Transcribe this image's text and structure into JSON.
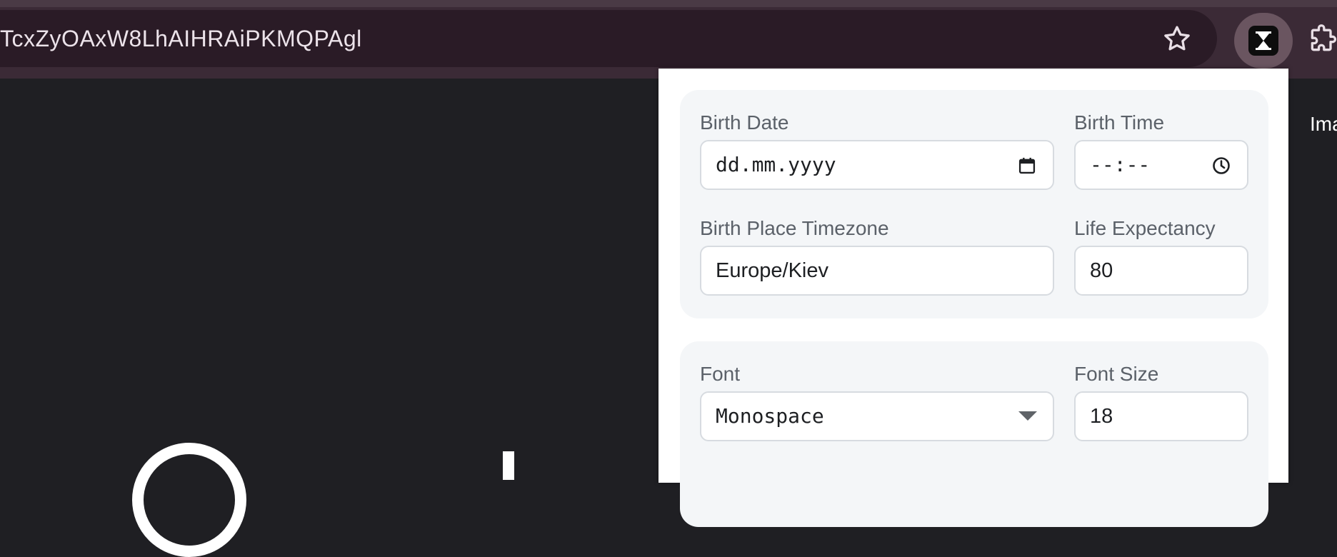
{
  "browser": {
    "address_bar": {
      "url_text": "TcxZyOAxW8LhAIHRAiPKMQPAgl"
    },
    "icons": {
      "bookmark": "star-icon",
      "active_extension": "hourglass-icon",
      "extensions_menu": "puzzle-icon"
    },
    "colors": {
      "toolbar": "#3b2a36",
      "omnibox": "#2a1b26",
      "page_background": "#1f1f23"
    }
  },
  "page": {
    "side_text": "Ima"
  },
  "popup": {
    "birth_date": {
      "label": "Birth Date",
      "placeholder": "dd.mm.yyyy",
      "icon": "calendar-icon"
    },
    "birth_time": {
      "label": "Birth Time",
      "placeholder": "--:--",
      "icon": "clock-icon"
    },
    "timezone": {
      "label": "Birth Place Timezone",
      "value": "Europe/Kiev"
    },
    "life_expectancy": {
      "label": "Life Expectancy",
      "value": "80"
    },
    "font": {
      "label": "Font",
      "selected": "Monospace",
      "icon": "dropdown-arrow-icon"
    },
    "font_size": {
      "label": "Font Size",
      "value": "18"
    },
    "colors": {
      "card_background": "#f4f6f8",
      "field_border": "#d7dbe0",
      "label_text": "#5b6169"
    }
  }
}
